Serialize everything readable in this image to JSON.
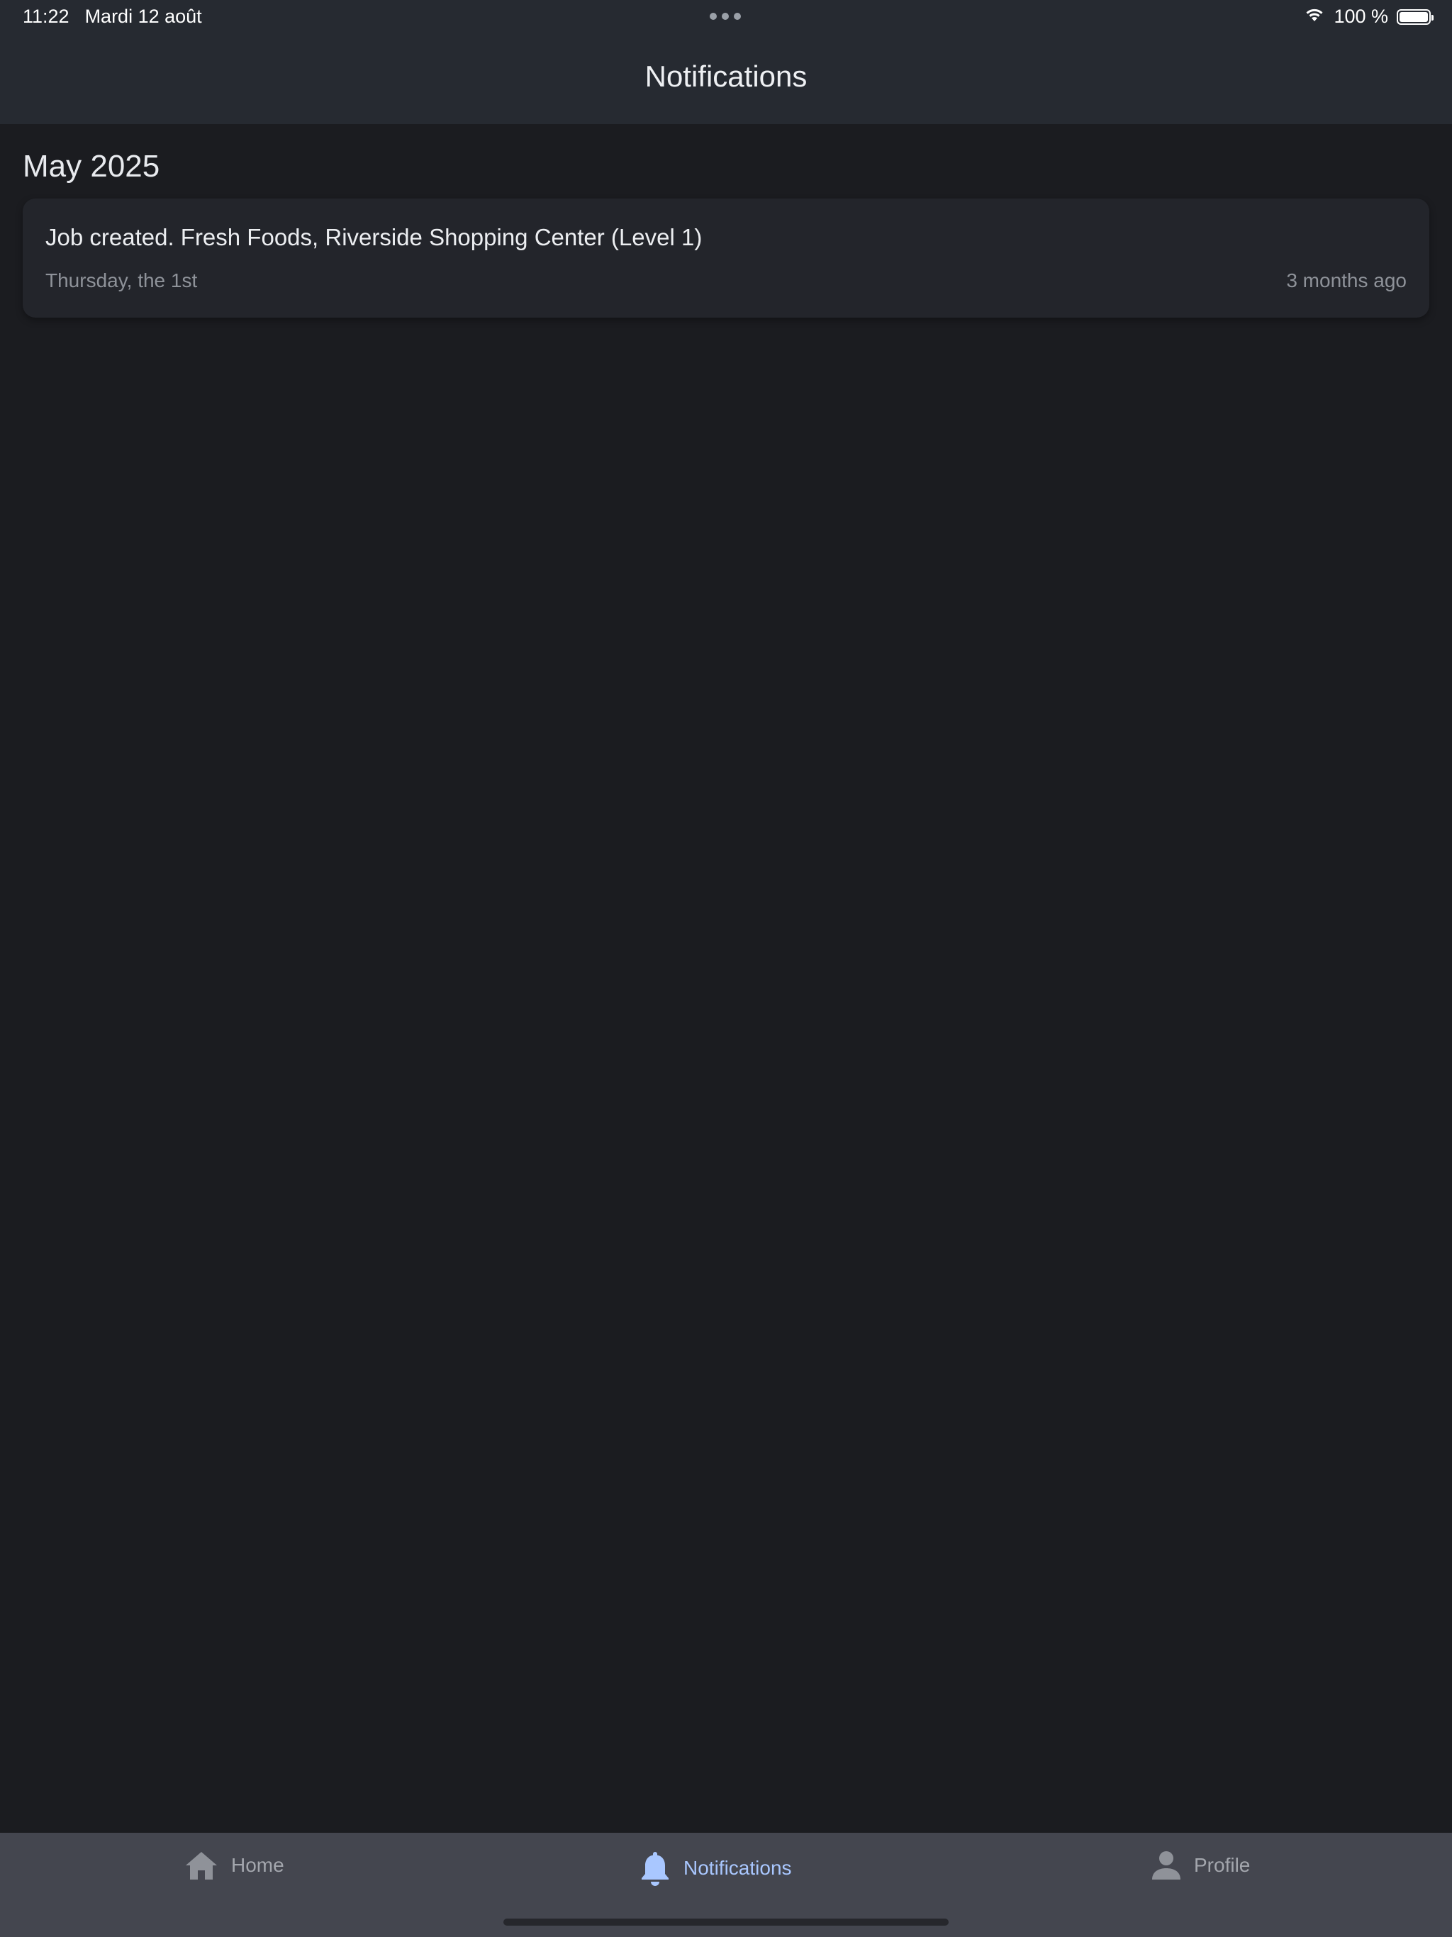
{
  "status_bar": {
    "time": "11:22",
    "date": "Mardi 12 août",
    "battery_percent": "100 %",
    "battery_level": 1.0
  },
  "app_bar": {
    "title": "Notifications"
  },
  "sections": [
    {
      "title": "May 2025",
      "notifications": [
        {
          "message": "Job created. Fresh Foods, Riverside Shopping Center (Level 1)",
          "date": "Thursday, the 1st",
          "relative_time": "3 months ago"
        }
      ]
    }
  ],
  "bottom_nav": {
    "items": [
      {
        "label": "Home",
        "icon": "home-icon",
        "active": false
      },
      {
        "label": "Notifications",
        "icon": "bell-icon",
        "active": true
      },
      {
        "label": "Profile",
        "icon": "person-icon",
        "active": false
      }
    ]
  },
  "colors": {
    "background": "#1b1c20",
    "app_bar": "#262a31",
    "card": "#23252b",
    "nav_bar": "#44464f",
    "nav_active": "#a9c7ff",
    "nav_inactive": "#a3a6ad",
    "secondary_text": "#8e9299"
  }
}
